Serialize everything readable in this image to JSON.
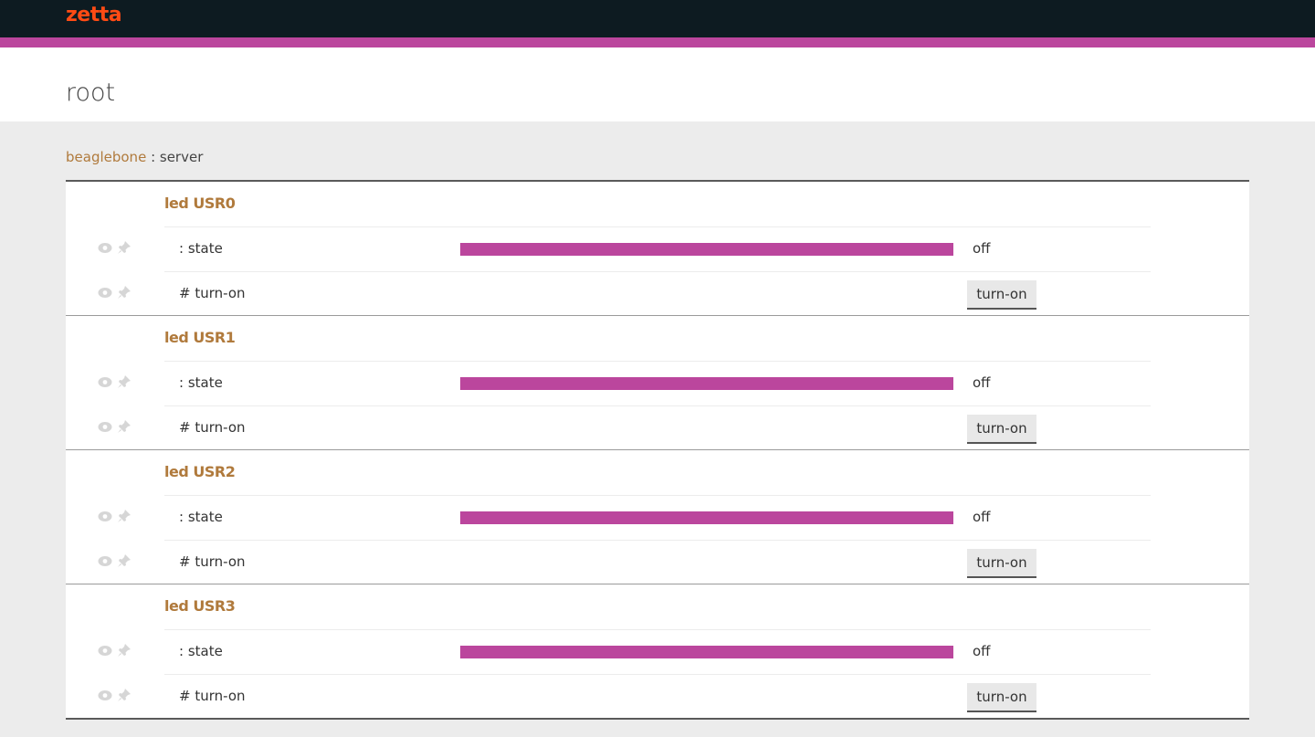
{
  "app": {
    "logo": "zetta"
  },
  "colors": {
    "accent": "#bb469d",
    "topbar": "#0d1b21",
    "logo": "#ff4b14",
    "link": "#b07a3c"
  },
  "page": {
    "title": "root"
  },
  "breadcrumb": {
    "server_name": "beaglebone",
    "separator": " : ",
    "type": "server"
  },
  "devices": [
    {
      "name": "led USR0",
      "state_label": ": state",
      "state_value": "off",
      "transition_label": "# turn-on",
      "button_label": "turn-on"
    },
    {
      "name": "led USR1",
      "state_label": ": state",
      "state_value": "off",
      "transition_label": "# turn-on",
      "button_label": "turn-on"
    },
    {
      "name": "led USR2",
      "state_label": ": state",
      "state_value": "off",
      "transition_label": "# turn-on",
      "button_label": "turn-on"
    },
    {
      "name": "led USR3",
      "state_label": ": state",
      "state_value": "off",
      "transition_label": "# turn-on",
      "button_label": "turn-on"
    }
  ],
  "icons": {
    "view": "eye-icon",
    "pin": "pin-icon"
  }
}
